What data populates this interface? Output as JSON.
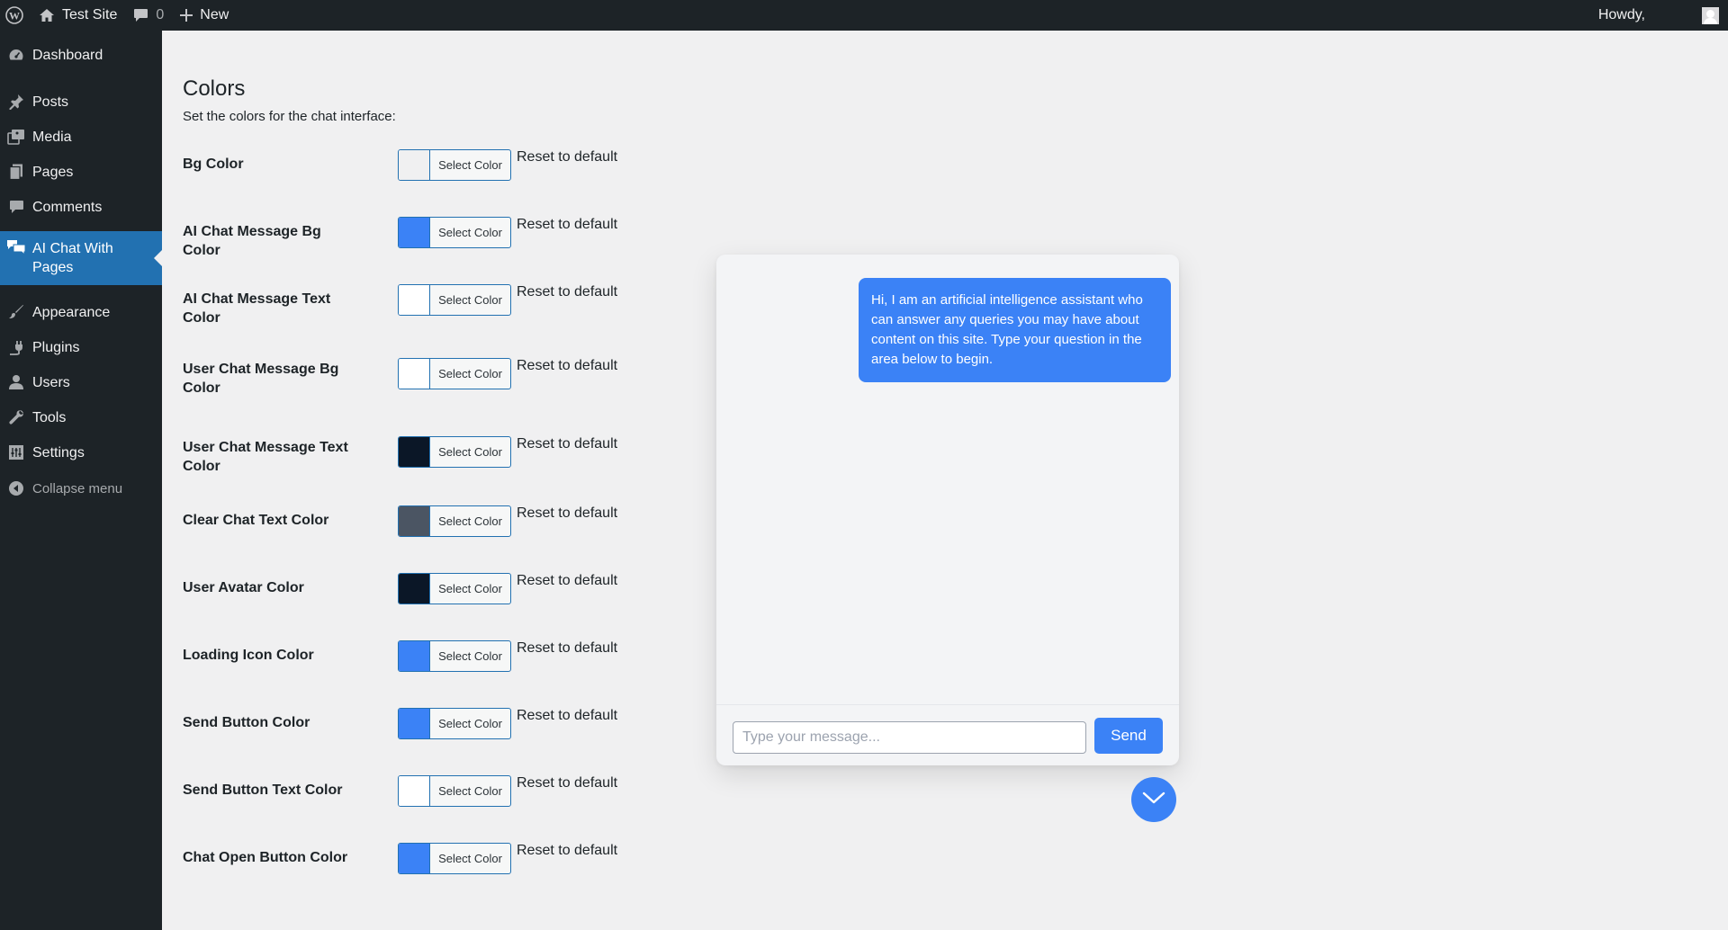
{
  "admin_bar": {
    "site_name": "Test Site",
    "comments_count": "0",
    "new_label": "New",
    "howdy": "Howdy,"
  },
  "sidebar": {
    "items": [
      {
        "label": "Dashboard",
        "icon": "dashboard-icon"
      },
      {
        "label": "Posts",
        "icon": "pin-icon"
      },
      {
        "label": "Media",
        "icon": "media-icon"
      },
      {
        "label": "Pages",
        "icon": "pages-icon"
      },
      {
        "label": "Comments",
        "icon": "comment-icon"
      },
      {
        "label": "AI Chat With Pages",
        "icon": "chat-icon",
        "active": true
      },
      {
        "label": "Appearance",
        "icon": "brush-icon"
      },
      {
        "label": "Plugins",
        "icon": "plugin-icon"
      },
      {
        "label": "Users",
        "icon": "users-icon"
      },
      {
        "label": "Tools",
        "icon": "wrench-icon"
      },
      {
        "label": "Settings",
        "icon": "settings-icon"
      }
    ],
    "collapse_label": "Collapse menu"
  },
  "main": {
    "title": "Colors",
    "description": "Set the colors for the chat interface:",
    "picker_label": "Select Color",
    "reset_label": "Reset to default",
    "settings": [
      {
        "label": "Bg Color",
        "color": "#f0f0f1"
      },
      {
        "label": "AI Chat Message Bg Color",
        "color": "#3b82f6"
      },
      {
        "label": "AI Chat Message Text Color",
        "color": "#ffffff"
      },
      {
        "label": "User Chat Message Bg Color",
        "color": "#ffffff"
      },
      {
        "label": "User Chat Message Text Color",
        "color": "#0b1727"
      },
      {
        "label": "Clear Chat Text Color",
        "color": "#4b5563"
      },
      {
        "label": "User Avatar Color",
        "color": "#0b1727"
      },
      {
        "label": "Loading Icon Color",
        "color": "#3b82f6"
      },
      {
        "label": "Send Button Color",
        "color": "#3b82f6"
      },
      {
        "label": "Send Button Text Color",
        "color": "#ffffff"
      },
      {
        "label": "Chat Open Button Color",
        "color": "#3b82f6"
      }
    ]
  },
  "chat": {
    "ai_message": "Hi, I am an artificial intelligence assistant who can answer any queries you may have about content on this site. Type your question in the area below to begin.",
    "input_placeholder": "Type your message...",
    "send_label": "Send",
    "toggle_icon": "chevron-down-icon"
  },
  "colors": {
    "admin_bg": "#1d2327",
    "accent": "#2271b1",
    "chat_blue": "#3b82f6"
  }
}
